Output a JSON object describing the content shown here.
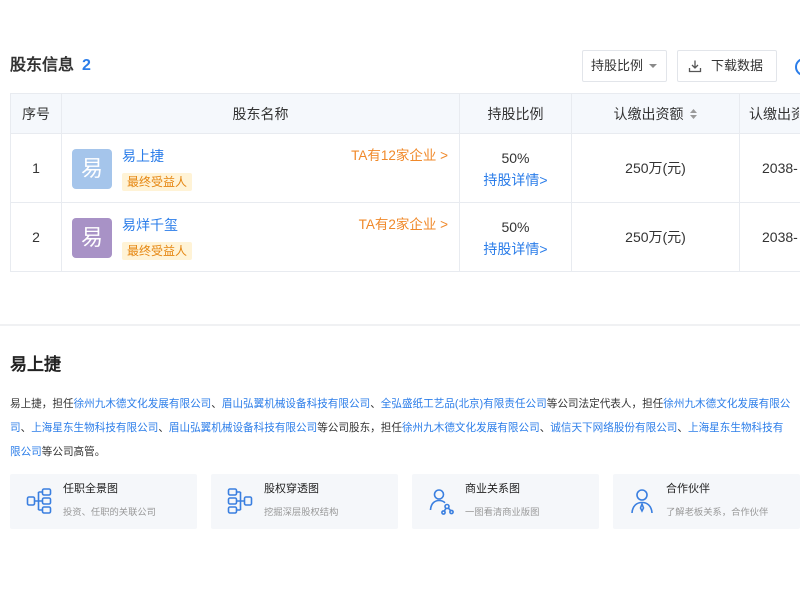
{
  "section": {
    "title": "股东信息",
    "count": "2",
    "sort_dropdown": {
      "label": "持股比例"
    },
    "download_button": {
      "label": "下载数据"
    }
  },
  "table": {
    "columns": [
      "序号",
      "股东名称",
      "持股比例",
      "认缴出资额",
      "认缴出资"
    ],
    "rows": [
      {
        "index": "1",
        "avatar_text": "易",
        "avatar_color": "#a5c5eb",
        "name": "易上捷",
        "badge": "最终受益人",
        "companies_link": "TA有12家企业 >",
        "ratio": "50%",
        "ratio_detail": "持股详情>",
        "subscribed_amount": "250万(元)",
        "subscribed_date": "2038-"
      },
      {
        "index": "2",
        "avatar_text": "易",
        "avatar_color": "#a892c6",
        "name": "易烊千玺",
        "badge": "最终受益人",
        "companies_link": "TA有2家企业 >",
        "ratio": "50%",
        "ratio_detail": "持股详情>",
        "subscribed_amount": "250万(元)",
        "subscribed_date": "2038-"
      }
    ]
  },
  "profile": {
    "name": "易上捷",
    "summary_lines": [
      [
        {
          "text": "易上捷，担任",
          "link": false
        },
        {
          "text": "徐州九木德文化发展有限公司",
          "link": true
        },
        {
          "text": "、",
          "link": false
        },
        {
          "text": "眉山弘翼机械设备科技有限公司",
          "link": true
        },
        {
          "text": "、",
          "link": false
        },
        {
          "text": "全弘盛纸工艺品(北京)有限责任公司",
          "link": true
        },
        {
          "text": "等公司法定代表人，担任",
          "link": false
        },
        {
          "text": "徐州九木德文化发展有限公",
          "link": true
        }
      ],
      [
        {
          "text": "司",
          "link": true
        },
        {
          "text": "、",
          "link": false
        },
        {
          "text": "上海星东生物科技有限公司",
          "link": true
        },
        {
          "text": "、",
          "link": false
        },
        {
          "text": "眉山弘翼机械设备科技有限公司",
          "link": true
        },
        {
          "text": "等公司股东，担任",
          "link": false
        },
        {
          "text": "徐州九木德文化发展有限公司",
          "link": true
        },
        {
          "text": "、",
          "link": false
        },
        {
          "text": "诚信天下网络股份有限公司",
          "link": true
        },
        {
          "text": "、",
          "link": false
        },
        {
          "text": "上海星东生物科技有",
          "link": true
        }
      ],
      [
        {
          "text": "限公司",
          "link": true
        },
        {
          "text": "等公司高管。",
          "link": false
        }
      ]
    ]
  },
  "cards": [
    {
      "title": "任职全景图",
      "subtitle": "投资、任职的关联公司",
      "icon": "org-tree-icon"
    },
    {
      "title": "股权穿透图",
      "subtitle": "挖掘深层股权结构",
      "icon": "equity-structure-icon"
    },
    {
      "title": "商业关系图",
      "subtitle": "一图看清商业版图",
      "icon": "relation-network-icon"
    },
    {
      "title": "合作伙伴",
      "subtitle": "了解老板关系，合作伙伴",
      "icon": "partner-person-icon"
    }
  ],
  "colors": {
    "accent": "#2b7de9",
    "orange": "#f0892a",
    "badge_bg": "#fff3d6",
    "badge_text": "#e5850f"
  }
}
